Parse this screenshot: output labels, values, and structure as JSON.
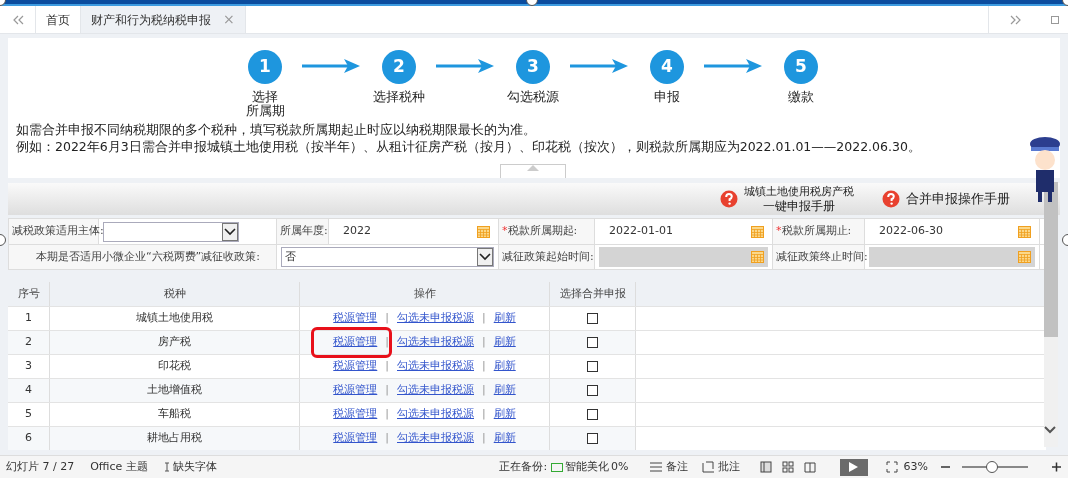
{
  "tabs": [
    {
      "label": "首页",
      "selected": false
    },
    {
      "label": "财产和行为税纳税申报",
      "selected": true,
      "close": "×"
    }
  ],
  "steps": [
    {
      "number": "1",
      "lines": [
        "选择",
        "所属期"
      ]
    },
    {
      "number": "2",
      "lines": [
        "选择税种"
      ]
    },
    {
      "number": "3",
      "lines": [
        "勾选税源"
      ]
    },
    {
      "number": "4",
      "lines": [
        "申报"
      ]
    },
    {
      "number": "5",
      "lines": [
        "缴款"
      ]
    }
  ],
  "notes": [
    "如需合并申报不同纳税期限的多个税种，填写税款所属期起止时应以纳税期限最长的为准。",
    "例如：2022年6月3日需合并申报城镇土地使用税（按半年）、从租计征房产税（按月）、印花税（按次），则税款所属期应为2022.01.01——2022.06.30。"
  ],
  "help_links": [
    {
      "lines": [
        "城镇土地使用税房产税",
        "一键申报手册"
      ]
    },
    {
      "lines": [
        "合并申报操作手册"
      ]
    }
  ],
  "form": {
    "rows": [
      {
        "fields": [
          {
            "label": "减税政策适用主体:",
            "kind": "select"
          },
          {
            "label": "所属年度:",
            "kind": "date",
            "value": "2022",
            "disabled": false
          },
          {
            "label": "税款所属期起:",
            "required_mark": "*",
            "kind": "date",
            "value": "2022-01-01",
            "disabled": false
          },
          {
            "label": "税款所属期止:",
            "required_mark": "*",
            "kind": "date",
            "value": "2022-06-30",
            "disabled": false
          }
        ]
      },
      {
        "fields": [
          {
            "label": "本期是否适用小微企业“六税两费”减征收政策:",
            "kind": "select",
            "value": "否"
          },
          {
            "label": "减征政策起始时间:",
            "kind": "date",
            "disabled": true
          },
          {
            "label": "减征政策终止时间:",
            "kind": "date",
            "disabled": true
          }
        ]
      }
    ]
  },
  "table": {
    "columns": [
      "序号",
      "税种",
      "操作",
      "选择合并申报"
    ],
    "rows": [
      {
        "index": "1",
        "tax": "城镇土地使用税",
        "actions": [
          "税源管理",
          "勾选未申报税源",
          "刷新"
        ],
        "separators": [
          "|",
          "|"
        ],
        "checked": false,
        "highlighted": false
      },
      {
        "index": "2",
        "tax": "房产税",
        "actions": [
          "税源管理",
          "勾选未申报税源",
          "刷新"
        ],
        "separators": [
          "|",
          "|"
        ],
        "checked": false,
        "highlighted": true
      },
      {
        "index": "3",
        "tax": "印花税",
        "actions": [
          "税源管理",
          "勾选未申报税源",
          "刷新"
        ],
        "separators": [
          "|",
          "|"
        ],
        "checked": false,
        "highlighted": false
      },
      {
        "index": "4",
        "tax": "土地增值税",
        "actions": [
          "税源管理",
          "勾选未申报税源",
          "刷新"
        ],
        "separators": [
          "|",
          "|"
        ],
        "checked": false,
        "highlighted": false
      },
      {
        "index": "5",
        "tax": "车船税",
        "actions": [
          "税源管理",
          "勾选未申报税源",
          "刷新"
        ],
        "separators": [
          "|",
          "|"
        ],
        "checked": false,
        "highlighted": false
      },
      {
        "index": "6",
        "tax": "耕地占用税",
        "actions": [
          "税源管理",
          "勾选未申报税源",
          "刷新"
        ],
        "separators": [
          "|",
          "|"
        ],
        "checked": false,
        "highlighted": false
      }
    ]
  },
  "status_bar": {
    "slide": "幻灯片 7 / 27",
    "theme": "Office 主题",
    "missing_font": "缺失字体",
    "backup": "正在备份:",
    "beautify": "智能美化",
    "progress": "0%",
    "notes": "备注",
    "comments": "批注",
    "zoom": "63%",
    "zoom_slider": {
      "level": 0.45
    }
  }
}
